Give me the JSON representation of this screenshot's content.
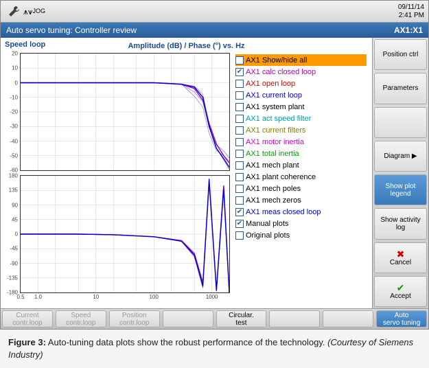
{
  "topbar": {
    "jog_label": "JOG",
    "date": "09/11/14",
    "time": "2:41 PM"
  },
  "titlebar": {
    "title": "Auto servo tuning: Controller review",
    "axis": "AX1:X1"
  },
  "plot": {
    "speed_label": "Speed loop",
    "title": "Amplitude (dB) / Phase (°) vs. Hz"
  },
  "amp": {
    "ticks": [
      "20",
      "10",
      "0",
      "-10",
      "-20",
      "-30",
      "-40",
      "-50",
      "-60"
    ]
  },
  "phase": {
    "ticks": [
      "180",
      "135",
      "90",
      "45",
      "0",
      "-45",
      "-90",
      "-135",
      "-180"
    ]
  },
  "xticks": [
    "0.5",
    "1.0",
    "10",
    "100",
    "1000"
  ],
  "legend": [
    {
      "label": "AX1 Show/hide all",
      "color": "#000",
      "checked": false,
      "sel": true
    },
    {
      "label": "AX1 calc closed loop",
      "color": "#b000b0",
      "checked": true
    },
    {
      "label": "AX1 open loop",
      "color": "#d00000",
      "checked": false
    },
    {
      "label": "AX1 current loop",
      "color": "#0000d0",
      "checked": false
    },
    {
      "label": "AX1 system plant",
      "color": "#000",
      "checked": false
    },
    {
      "label": "AX1 act speed filter",
      "color": "#00a0a0",
      "checked": false
    },
    {
      "label": "AX1 current filters",
      "color": "#808000",
      "checked": false
    },
    {
      "label": "AX1 motor inertia",
      "color": "#d000d0",
      "checked": false
    },
    {
      "label": "AX1 total inertia",
      "color": "#00a000",
      "checked": false
    },
    {
      "label": "AX1 mech plant",
      "color": "#000",
      "checked": false
    },
    {
      "label": "AX1 plant coherence",
      "color": "#000",
      "checked": false
    },
    {
      "label": "AX1 mech poles",
      "color": "#000",
      "checked": false
    },
    {
      "label": "AX1 mech zeros",
      "color": "#000",
      "checked": false
    },
    {
      "label": "AX1 meas closed loop",
      "color": "#0000d0",
      "checked": true
    },
    {
      "label": "Manual plots",
      "color": "#000",
      "checked": true
    },
    {
      "label": "Original plots",
      "color": "#000",
      "checked": false
    }
  ],
  "sidebar": [
    {
      "label": "Position ctrl",
      "name": "position-ctrl-button"
    },
    {
      "label": "Parameters",
      "name": "parameters-button"
    },
    {
      "label": "",
      "name": "blank-button-1"
    },
    {
      "label": "Diagram",
      "name": "diagram-button",
      "arrow": true
    },
    {
      "label": "Show plot legend",
      "name": "show-plot-legend-button",
      "active": true
    },
    {
      "label": "Show activity log",
      "name": "show-activity-log-button"
    },
    {
      "label": "Cancel",
      "name": "cancel-button",
      "icon": "✖",
      "iconColor": "#d00000"
    },
    {
      "label": "Accept",
      "name": "accept-button",
      "icon": "✔",
      "iconColor": "#00a000"
    }
  ],
  "bottombar": [
    {
      "label": "Current contr.loop",
      "name": "current-contrloop-tab",
      "dim": true
    },
    {
      "label": "Speed contr.loop",
      "name": "speed-contrloop-tab",
      "dim": true
    },
    {
      "label": "Position contr.loop",
      "name": "position-contrloop-tab",
      "dim": true
    },
    {
      "label": "",
      "name": "blank-tab-1"
    },
    {
      "label": "Circular. test",
      "name": "circular-test-tab"
    },
    {
      "label": "",
      "name": "blank-tab-2"
    },
    {
      "label": "",
      "name": "blank-tab-3"
    },
    {
      "label": "Auto servo tuning",
      "name": "auto-servo-tuning-tab",
      "active": true
    }
  ],
  "caption": {
    "fig": "Figure 3:",
    "text": " Auto-tuning data plots show the robust performance of the technology. ",
    "credit": "(Courtesy of Siemens Industry)"
  },
  "chart_data": [
    {
      "type": "line",
      "title": "Amplitude (dB) vs. Hz",
      "xlabel": "Hz",
      "ylabel": "Amplitude (dB)",
      "xscale": "log",
      "xlim": [
        0.5,
        2000
      ],
      "ylim": [
        -60,
        20
      ],
      "series": [
        {
          "name": "AX1 calc closed loop",
          "color": "#b000b0",
          "x": [
            0.5,
            1,
            5,
            20,
            100,
            300,
            500,
            700,
            900,
            1200,
            1600,
            2000
          ],
          "y": [
            0,
            0,
            0,
            0,
            0,
            -1,
            -4,
            -12,
            -28,
            -42,
            -50,
            -55
          ]
        },
        {
          "name": "AX1 meas closed loop",
          "color": "#0000d0",
          "x": [
            0.5,
            1,
            5,
            20,
            100,
            300,
            500,
            700,
            900,
            1200,
            1600,
            2000
          ],
          "y": [
            0,
            0,
            0,
            0,
            0,
            -1,
            -3,
            -10,
            -30,
            -45,
            -52,
            -58
          ]
        }
      ]
    },
    {
      "type": "line",
      "title": "Phase (°) vs. Hz",
      "xlabel": "Hz",
      "ylabel": "Phase (°)",
      "xscale": "log",
      "xlim": [
        0.5,
        2000
      ],
      "ylim": [
        -180,
        180
      ],
      "series": [
        {
          "name": "AX1 calc closed loop",
          "color": "#b000b0",
          "x": [
            0.5,
            1,
            5,
            20,
            100,
            300,
            500,
            700,
            900,
            1200,
            1600,
            2000
          ],
          "y": [
            0,
            0,
            0,
            -2,
            -8,
            -20,
            -60,
            -150,
            160,
            -170,
            150,
            -180
          ]
        },
        {
          "name": "AX1 meas closed loop",
          "color": "#0000d0",
          "x": [
            0.5,
            1,
            5,
            20,
            100,
            300,
            500,
            700,
            900,
            1200,
            1600,
            2000
          ],
          "y": [
            0,
            0,
            0,
            -2,
            -8,
            -22,
            -65,
            -160,
            170,
            -175,
            140,
            -180
          ]
        }
      ]
    }
  ]
}
